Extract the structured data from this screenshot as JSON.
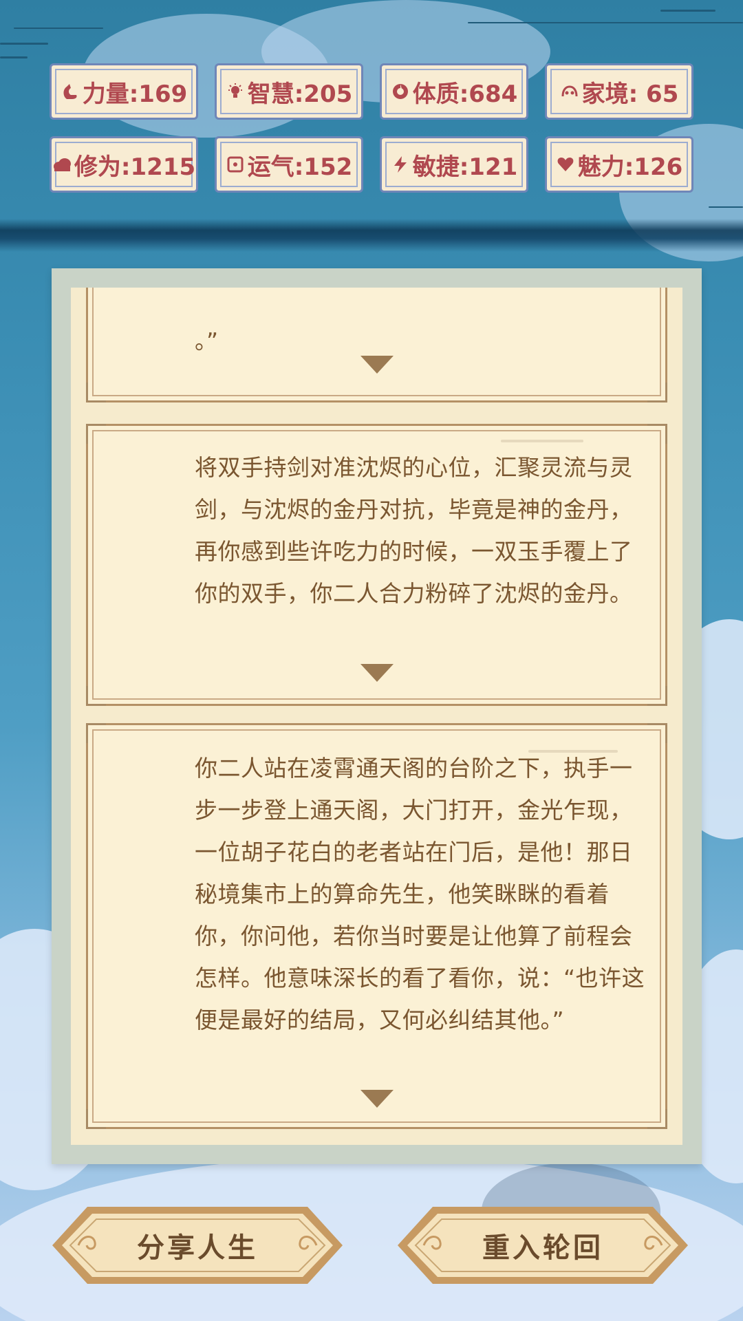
{
  "stats": [
    {
      "icon": "strength-icon",
      "text": "力量:169"
    },
    {
      "icon": "wisdom-icon",
      "text": "智慧:205"
    },
    {
      "icon": "constitution-icon",
      "text": "体质:684"
    },
    {
      "icon": "family-icon",
      "text": "家境: 65"
    },
    {
      "icon": "cultivation-icon",
      "text": "修为:1215"
    },
    {
      "icon": "luck-icon",
      "text": "运气:152"
    },
    {
      "icon": "agility-icon",
      "text": "敏捷:121"
    },
    {
      "icon": "charm-icon",
      "text": "魅力:126"
    }
  ],
  "story": {
    "card1_tail": "。”",
    "card2_text": "将双手持剑对准沈烬的心位，汇聚灵流与灵剑，与沈烬的金丹对抗，毕竟是神的金丹，再你感到些许吃力的时候，一双玉手覆上了你的双手，你二人合力粉碎了沈烬的金丹。",
    "card3_text": "你二人站在凌霄通天阁的台阶之下，执手一步一步登上通天阁，大门打开，金光乍现，一位胡子花白的老者站在门后，是他！那日秘境集市上的算命先生，他笑眯眯的看着你，你问他，若你当时要是让他算了前程会怎样。他意味深长的看了看你，说：“也许这便是最好的结局，又何必纠结其他。”"
  },
  "buttons": {
    "share": "分享人生",
    "restart": "重入轮回"
  },
  "colors": {
    "stat_text": "#b0484f",
    "story_text": "#7a5630",
    "card_bg": "#fbf1d5",
    "card_border": "#b49065"
  }
}
